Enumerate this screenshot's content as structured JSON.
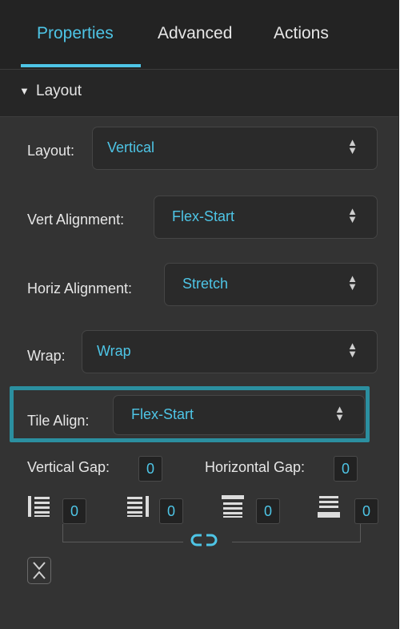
{
  "tabs": [
    {
      "label": "Properties",
      "active": true
    },
    {
      "label": "Advanced",
      "active": false
    },
    {
      "label": "Actions",
      "active": false
    }
  ],
  "section": {
    "title": "Layout",
    "expanded": true
  },
  "fields": {
    "layout": {
      "label": "Layout:",
      "value": "Vertical"
    },
    "vert_alignment": {
      "label": "Vert Alignment:",
      "value": "Flex-Start"
    },
    "horiz_alignment": {
      "label": "Horiz Alignment:",
      "value": "Stretch"
    },
    "wrap": {
      "label": "Wrap:",
      "value": "Wrap"
    },
    "tile_align": {
      "label": "Tile Align:",
      "value": "Flex-Start"
    }
  },
  "gaps": {
    "vertical_label": "Vertical Gap:",
    "vertical_value": "0",
    "horizontal_label": "Horizontal Gap:",
    "horizontal_value": "0"
  },
  "padding": {
    "left": "0",
    "right": "0",
    "top": "0",
    "bottom": "0"
  },
  "colors": {
    "accent": "#4ec5e6",
    "highlight_border": "#2b8fa0",
    "panel": "#333333"
  }
}
